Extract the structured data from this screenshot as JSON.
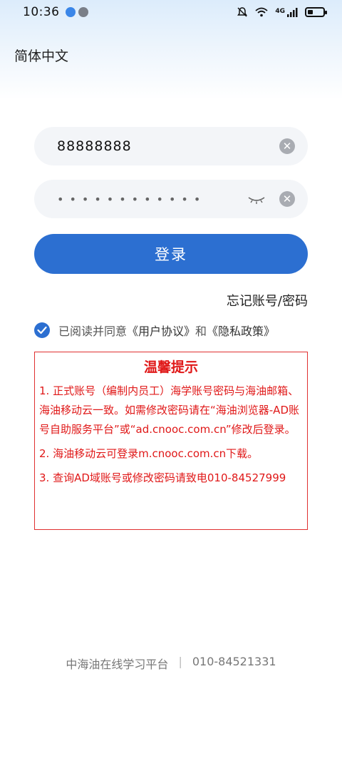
{
  "status_bar": {
    "time": "10:36",
    "network": "4G",
    "battery_level": 0.35
  },
  "language": "简体中文",
  "account": {
    "value": "88888888"
  },
  "password": {
    "masked": "••••••••••••"
  },
  "login_label": "登录",
  "forgot_label": "忘记账号/密码",
  "agreement": {
    "prefix": "已阅读并同意",
    "user_agreement": "《用户协议》",
    "and": "和",
    "privacy_policy": "《隐私政策》"
  },
  "notice": {
    "title": "温馨提示",
    "items": [
      "1. 正式账号（编制内员工）海学账号密码与海油邮箱、海油移动云一致。如需修改密码请在“海油浏览器-AD账号自助服务平台”或“ad.cnooc.com.cn”修改后登录。",
      "2. 海油移动云可登录m.cnooc.com.cn下载。",
      "3. 查询AD域账号或修改密码请致电010-84527999"
    ]
  },
  "footer": {
    "name": "中海油在线学习平台",
    "separator": "|",
    "phone": "010-84521331"
  },
  "colors": {
    "primary": "#2c6fd1",
    "notice_red": "#e01818"
  }
}
